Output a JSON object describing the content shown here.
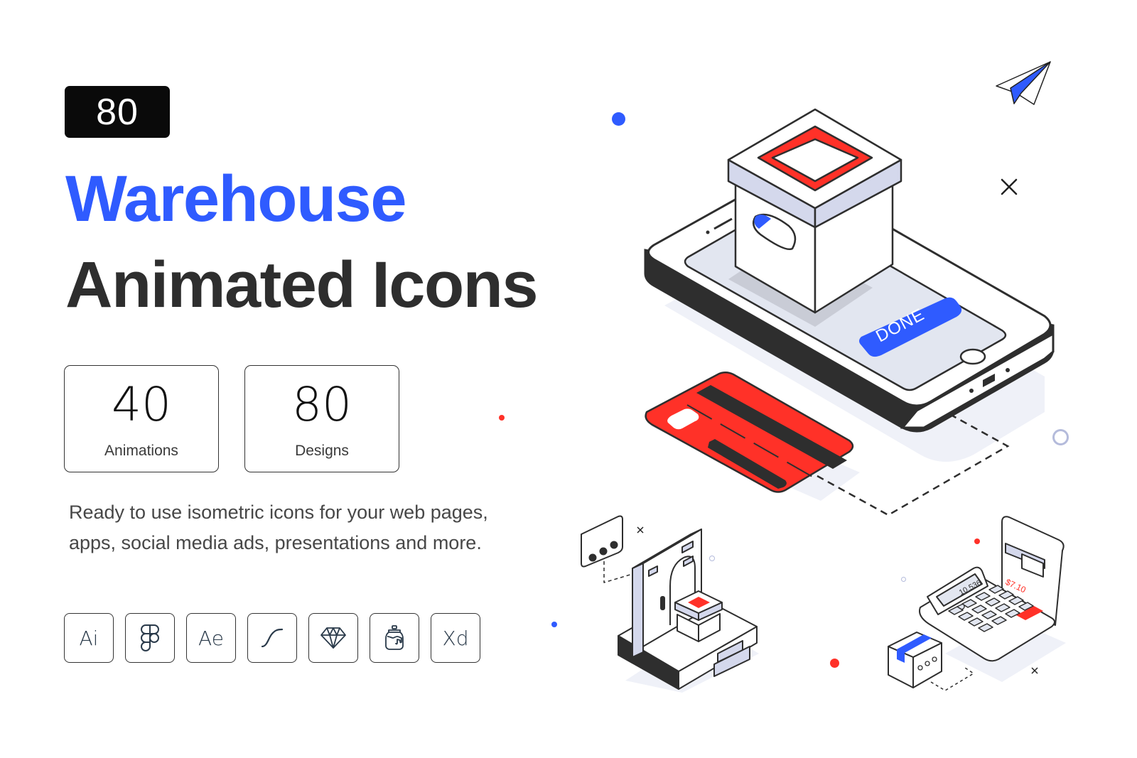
{
  "badge": {
    "count": "80"
  },
  "title": {
    "line1": "Warehouse",
    "line2": "Animated Icons"
  },
  "stats": [
    {
      "value": "40",
      "label": "Animations"
    },
    {
      "value": "80",
      "label": "Designs"
    }
  ],
  "description": "Ready to use isometric icons for your web pages, apps, social media ads, presentations and more.",
  "tools": [
    {
      "label": "Ai",
      "icon": "illustrator-icon"
    },
    {
      "label": "",
      "icon": "figma-icon"
    },
    {
      "label": "Ae",
      "icon": "after-effects-icon"
    },
    {
      "label": "",
      "icon": "bezier-curve-icon"
    },
    {
      "label": "",
      "icon": "sketch-icon"
    },
    {
      "label": "",
      "icon": "lottie-jar-icon"
    },
    {
      "label": "Xd",
      "icon": "adobe-xd-icon"
    }
  ],
  "illustration": {
    "phone_button": "DONE",
    "calculator_display": "10.536",
    "receipt_price": "$7.10"
  },
  "colors": {
    "accent_blue": "#2f5bff",
    "accent_red": "#ff3128",
    "dark": "#2e2e2e",
    "light_lavender": "#d4d8ec",
    "screen_gray": "#e2e6f0",
    "shadow": "#eff1f8"
  }
}
